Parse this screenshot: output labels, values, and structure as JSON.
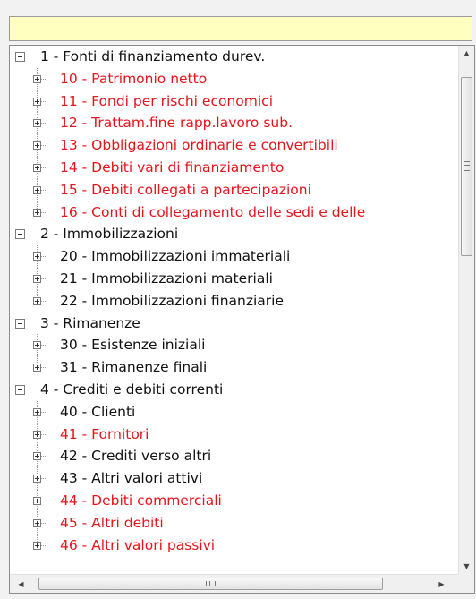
{
  "search": {
    "value": ""
  },
  "tree": {
    "groups": [
      {
        "label": "1 - Fonti di finanziamento durev.",
        "items": [
          {
            "label": "10 - Patrimonio netto",
            "color": "#e8141c"
          },
          {
            "label": "11 - Fondi per rischi economici",
            "color": "#e8141c"
          },
          {
            "label": "12 - Trattam.fine rapp.lavoro sub.",
            "color": "#e8141c"
          },
          {
            "label": "13 - Obbligazioni ordinarie e convertibili",
            "color": "#e8141c"
          },
          {
            "label": "14 - Debiti vari di finanziamento",
            "color": "#e8141c"
          },
          {
            "label": "15 - Debiti collegati a partecipazioni",
            "color": "#e8141c"
          },
          {
            "label": "16 - Conti di collegamento delle sedi e delle",
            "color": "#e8141c"
          }
        ]
      },
      {
        "label": "2 - Immobilizzazioni",
        "items": [
          {
            "label": "20 - Immobilizzazioni immateriali",
            "color": "#111111"
          },
          {
            "label": "21 - Immobilizzazioni materiali",
            "color": "#111111"
          },
          {
            "label": "22 - Immobilizzazioni finanziarie",
            "color": "#111111"
          }
        ]
      },
      {
        "label": "3 - Rimanenze",
        "items": [
          {
            "label": "30 - Esistenze iniziali",
            "color": "#111111"
          },
          {
            "label": "31 - Rimanenze finali",
            "color": "#111111"
          }
        ]
      },
      {
        "label": "4 - Crediti e debiti correnti",
        "items": [
          {
            "label": "40 - Clienti",
            "color": "#111111"
          },
          {
            "label": "41 - Fornitori",
            "color": "#e8141c"
          },
          {
            "label": "42 - Crediti verso altri",
            "color": "#111111"
          },
          {
            "label": "43 - Altri valori attivi",
            "color": "#111111"
          },
          {
            "label": "44 - Debiti commerciali",
            "color": "#e8141c"
          },
          {
            "label": "45 - Altri debiti",
            "color": "#e8141c"
          },
          {
            "label": "46 - Altri valori passivi",
            "color": "#e8141c"
          }
        ]
      }
    ]
  },
  "scrollbars": {
    "vertical": {
      "up_icon": "arrow-up-icon",
      "down_icon": "arrow-down-icon",
      "thumb_glyph": "≡",
      "position": 0.0
    },
    "horizontal": {
      "left_icon": "arrow-left-icon",
      "right_icon": "arrow-right-icon",
      "thumb_glyph": "III",
      "position": 0.0
    }
  },
  "colors": {
    "highlight_input": "#ffffc0",
    "red_text": "#e8141c",
    "normal_text": "#111111"
  }
}
